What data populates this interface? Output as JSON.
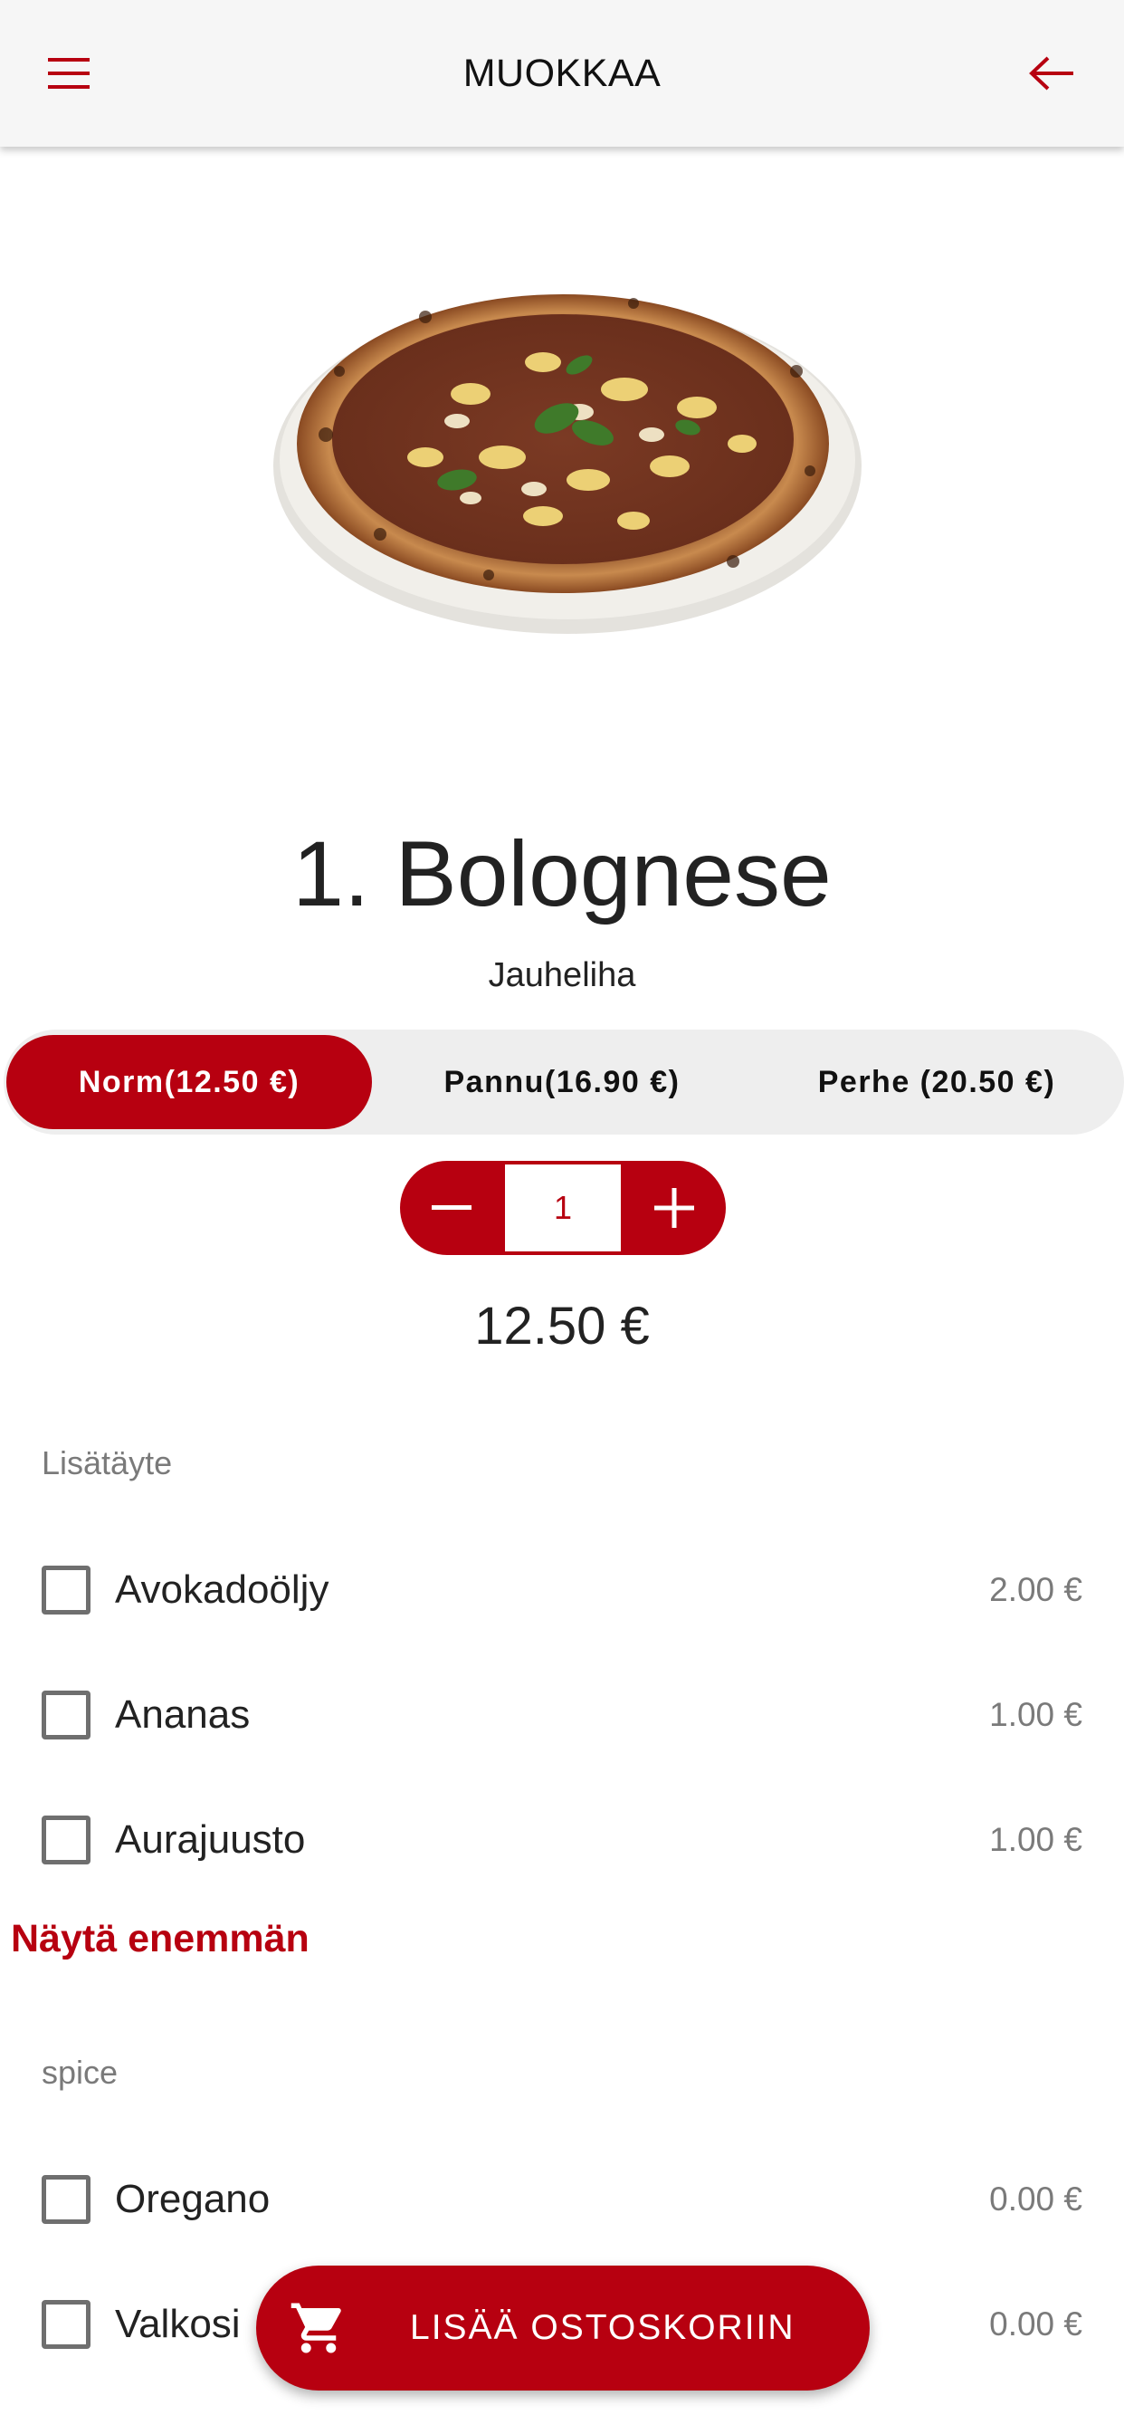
{
  "colors": {
    "accent": "#b70010",
    "header_bg": "#f6f6f6",
    "muted_text": "#7a7a7a"
  },
  "header": {
    "title": "MUOKKAA",
    "menu_icon": "hamburger-menu-icon",
    "back_icon": "arrow-back-icon"
  },
  "product": {
    "image": "pizza-photo",
    "name": "1. Bolognese",
    "description": "Jauheliha",
    "total_price": "12.50 €"
  },
  "sizes": [
    {
      "label": "Norm(12.50 €)",
      "selected": true
    },
    {
      "label": "Pannu(16.90 €)",
      "selected": false
    },
    {
      "label": "Perhe (20.50 €)",
      "selected": false
    }
  ],
  "quantity": {
    "value": "1",
    "minus_icon": "minus-icon",
    "plus_icon": "plus-icon"
  },
  "groups": [
    {
      "title": "Lisätäyte",
      "options": [
        {
          "label": "Avokadoöljy",
          "price": "2.00 €",
          "checked": false
        },
        {
          "label": "Ananas",
          "price": "1.00 €",
          "checked": false
        },
        {
          "label": "Aurajuusto",
          "price": "1.00 €",
          "checked": false
        }
      ],
      "show_more": "Näytä enemmän"
    },
    {
      "title": "spice",
      "options": [
        {
          "label": "Oregano",
          "price": "0.00 €",
          "checked": false
        },
        {
          "label": "Valkosi",
          "price": "0.00 €",
          "checked": false
        }
      ]
    }
  ],
  "cart_button": {
    "label": "LISÄÄ OSTOSKORIIN",
    "icon": "shopping-cart-icon"
  }
}
